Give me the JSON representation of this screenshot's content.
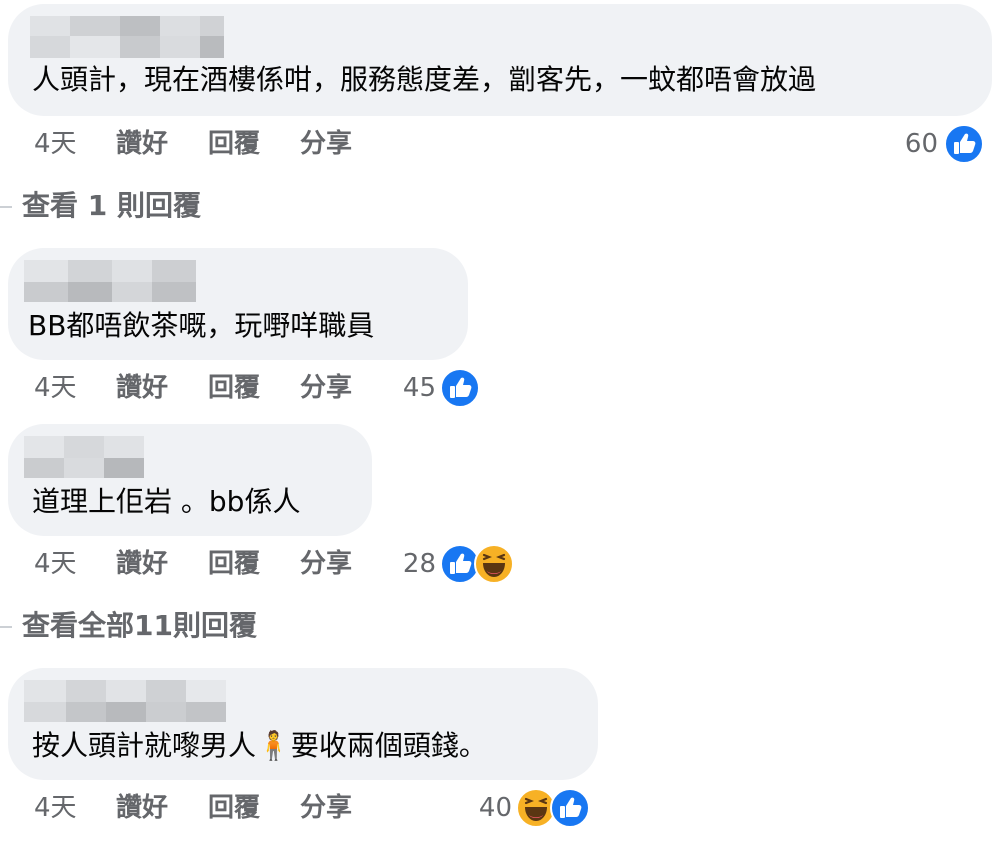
{
  "comments": [
    {
      "text": "人頭計，現在酒樓係咁，服務態度差，劏客先，一蚊都唔會放過",
      "time": "4天",
      "like": "讚好",
      "reply": "回覆",
      "share": "分享",
      "reaction_count": "60",
      "reactions": [
        "like-icon"
      ]
    },
    {
      "text": "BB都唔飲茶嘅，玩嘢咩職員",
      "time": "4天",
      "like": "讚好",
      "reply": "回覆",
      "share": "分享",
      "reaction_count": "45",
      "reactions": [
        "like-icon"
      ]
    },
    {
      "text": "道理上佢岩 。bb係人",
      "time": "4天",
      "like": "讚好",
      "reply": "回覆",
      "share": "分享",
      "reaction_count": "28",
      "reactions": [
        "like-icon",
        "haha-icon"
      ]
    },
    {
      "text": "按人頭計就嚟男人🧍要收兩個頭錢。",
      "time": "4天",
      "like": "讚好",
      "reply": "回覆",
      "share": "分享",
      "reaction_count": "40",
      "reactions": [
        "haha-icon",
        "like-icon"
      ]
    }
  ],
  "view_replies": [
    "查看 1 則回覆",
    "查看全部11則回覆"
  ],
  "colors": {
    "bubble": "#f0f2f5",
    "meta_text": "#65676b",
    "like_blue": "#1877f2",
    "haha_yellow": "#f7b125"
  }
}
